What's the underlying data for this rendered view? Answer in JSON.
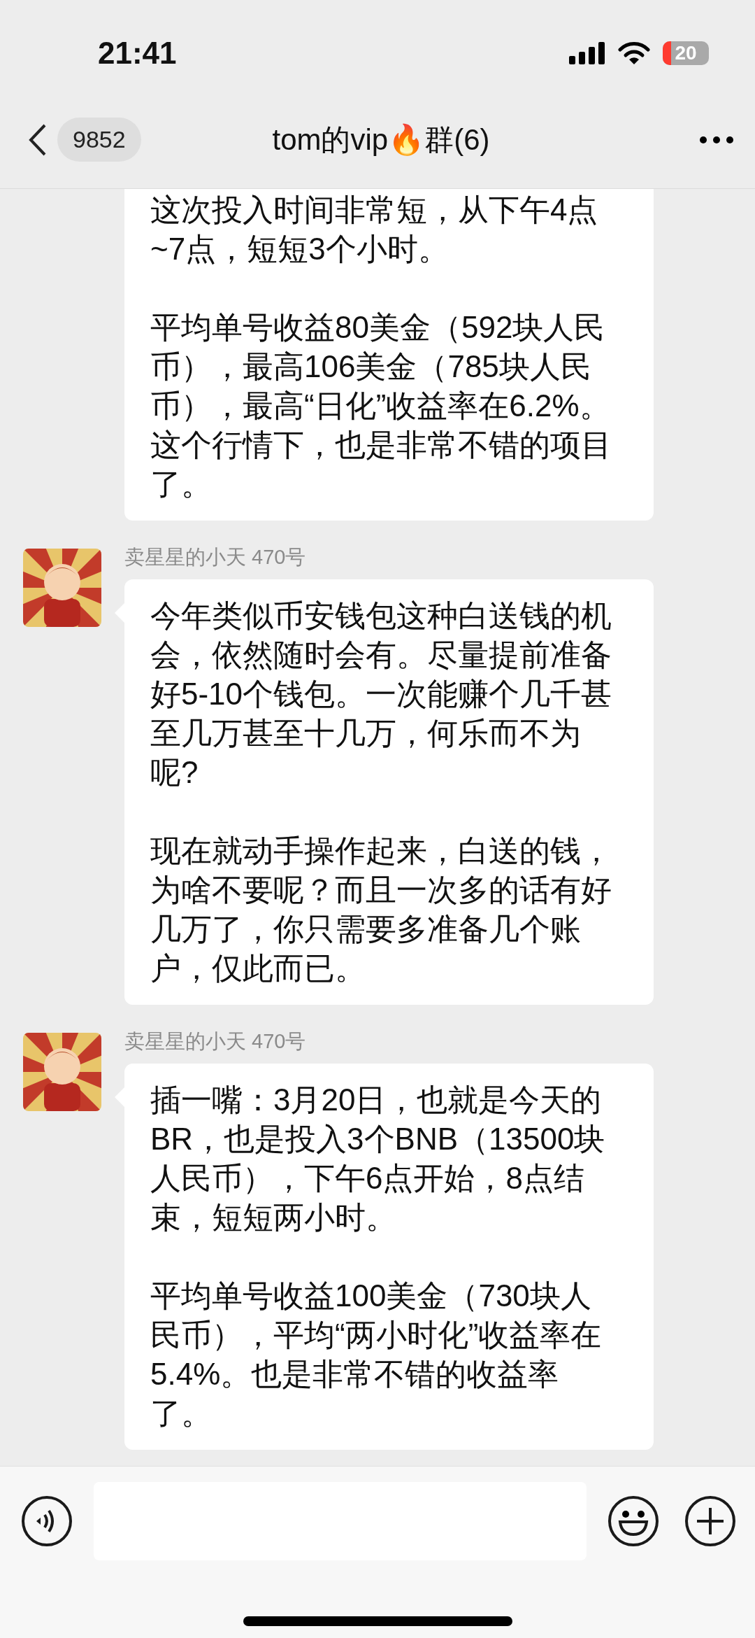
{
  "status_bar": {
    "time": "21:41",
    "battery": "20"
  },
  "nav": {
    "unread": "9852",
    "title": "tom的vip🔥群(6)"
  },
  "messages": [
    {
      "paragraphs": [
        "这次投入时间非常短，从下午4点~7点，短短3个小时。",
        "平均单号收益80美金（592块人民币），最高106美金（785块人民币），最高“日化”收益率在6.2%。这个行情下，也是非常不错的项目了。"
      ]
    },
    {
      "sender": "卖星星的小天 470号",
      "paragraphs": [
        "今年类似币安钱包这种白送钱的机会，依然随时会有。尽量提前准备好5-10个钱包。一次能赚个几千甚至几万甚至十几万，何乐而不为呢?",
        "现在就动手操作起来，白送的钱，为啥不要呢？而且一次多的话有好几万了，你只需要多准备几个账户，仅此而已。"
      ]
    },
    {
      "sender": "卖星星的小天 470号",
      "paragraphs": [
        "插一嘴：3月20日，也就是今天的BR，也是投入3个BNB（13500块人民币），下午6点开始，8点结束，短短两小时。",
        "平均单号收益100美金（730块人民币），平均“两小时化”收益率在5.4%。也是非常不错的收益率了。"
      ]
    }
  ]
}
